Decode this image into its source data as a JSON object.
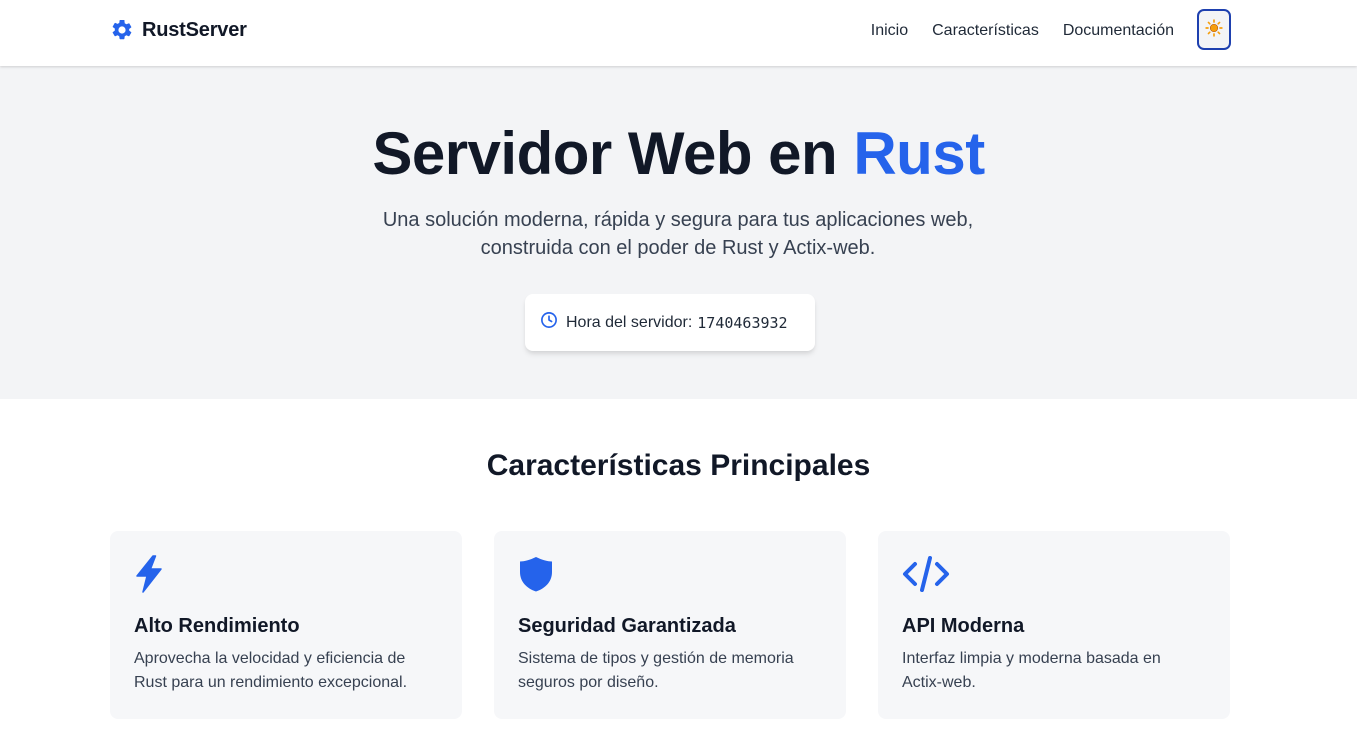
{
  "header": {
    "brand_name": "RustServer",
    "logo_icon": "gear-icon",
    "nav": [
      {
        "label": "Inicio"
      },
      {
        "label": "Características"
      },
      {
        "label": "Documentación"
      }
    ],
    "theme_toggle_icon": "sun-icon"
  },
  "hero": {
    "title_main": "Servidor Web en ",
    "title_accent": "Rust",
    "subtitle_line1": "Una solución moderna, rápida y segura para tus aplicaciones web,",
    "subtitle_line2": "construida con el poder de Rust y Actix-web.",
    "server_time_label": "Hora del servidor:",
    "server_time_value": "1740463932",
    "clock_icon": "clock-icon"
  },
  "features": {
    "heading": "Características Principales",
    "cards": [
      {
        "icon": "lightning-icon",
        "title": "Alto Rendimiento",
        "desc_line1": "Aprovecha la velocidad y eficiencia de",
        "desc_line2": "Rust para un rendimiento excepcional."
      },
      {
        "icon": "shield-icon",
        "title": "Seguridad Garantizada",
        "desc_line1": "Sistema de tipos y gestión de memoria",
        "desc_line2": "seguros por diseño."
      },
      {
        "icon": "code-icon",
        "title": "API Moderna",
        "desc_line1": "Interfaz limpia y moderna basada en",
        "desc_line2": "Actix-web."
      }
    ]
  },
  "colors": {
    "accent": "#2563eb",
    "hero_bg": "#f3f4f6",
    "card_bg": "#f6f7f9",
    "text_dark": "#111827",
    "sun": "#f59e0b"
  }
}
